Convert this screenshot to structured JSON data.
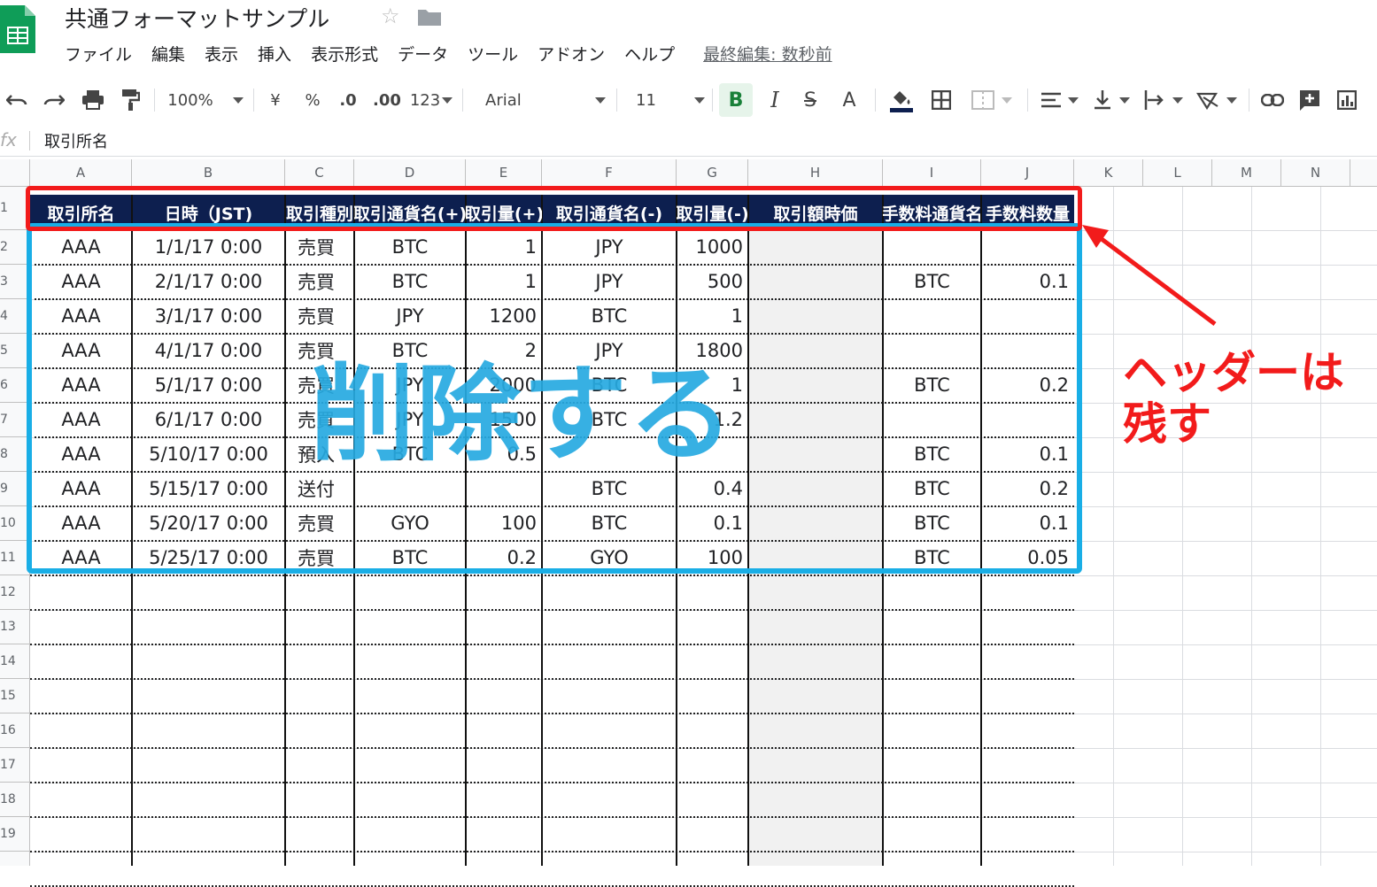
{
  "app": {
    "doc_title": "共通フォーマットサンプル",
    "menus": [
      "ファイル",
      "編集",
      "表示",
      "挿入",
      "表示形式",
      "データ",
      "ツール",
      "アドオン",
      "ヘルプ"
    ],
    "last_edit": "最終編集: 数秒前"
  },
  "toolbar": {
    "zoom": "100%",
    "currency": "¥",
    "percent": "%",
    "decimal_decrease": ".0",
    "decimal_increase": ".00",
    "more_formats": "123",
    "font": "Arial",
    "font_size": "11",
    "bold": "B",
    "italic": "I",
    "strike": "S",
    "text_color": "A"
  },
  "formula_bar": {
    "fx": "fx",
    "content": "取引所名"
  },
  "columns": [
    "A",
    "B",
    "C",
    "D",
    "E",
    "F",
    "G",
    "H",
    "I",
    "J",
    "K",
    "L",
    "M",
    "N"
  ],
  "rows": [
    "1",
    "2",
    "3",
    "4",
    "5",
    "6",
    "7",
    "8",
    "9",
    "10",
    "11",
    "12",
    "13",
    "14",
    "15",
    "16",
    "17",
    "18",
    "19"
  ],
  "headers": [
    "取引所名",
    "日時（JST)",
    "取引種別",
    "取引通貨名(+)",
    "取引量(+)",
    "取引通貨名(-)",
    "取引量(-)",
    "取引額時価",
    "手数料通貨名",
    "手数料数量"
  ],
  "data": [
    [
      "AAA",
      "1/1/17 0:00",
      "売買",
      "BTC",
      "1",
      "JPY",
      "1000",
      "",
      "",
      ""
    ],
    [
      "AAA",
      "2/1/17 0:00",
      "売買",
      "BTC",
      "1",
      "JPY",
      "500",
      "",
      "BTC",
      "0.1"
    ],
    [
      "AAA",
      "3/1/17 0:00",
      "売買",
      "JPY",
      "1200",
      "BTC",
      "1",
      "",
      "",
      ""
    ],
    [
      "AAA",
      "4/1/17 0:00",
      "売買",
      "BTC",
      "2",
      "JPY",
      "1800",
      "",
      "",
      ""
    ],
    [
      "AAA",
      "5/1/17 0:00",
      "売買",
      "JPY",
      "2000",
      "BTC",
      "1",
      "",
      "BTC",
      "0.2"
    ],
    [
      "AAA",
      "6/1/17 0:00",
      "売買",
      "JPY",
      "1500",
      "BTC",
      "1.2",
      "",
      "",
      ""
    ],
    [
      "AAA",
      "5/10/17 0:00",
      "預入",
      "BTC",
      "0.5",
      "",
      "",
      "",
      "BTC",
      "0.1"
    ],
    [
      "AAA",
      "5/15/17 0:00",
      "送付",
      "",
      "",
      "BTC",
      "0.4",
      "",
      "BTC",
      "0.2"
    ],
    [
      "AAA",
      "5/20/17 0:00",
      "売買",
      "GYO",
      "100",
      "BTC",
      "0.1",
      "",
      "BTC",
      "0.1"
    ],
    [
      "AAA",
      "5/25/17 0:00",
      "売買",
      "BTC",
      "0.2",
      "GYO",
      "100",
      "",
      "BTC",
      "0.05"
    ]
  ],
  "annotations": {
    "delete_label": "削除する",
    "keep_label_line1": "ヘッダーは",
    "keep_label_line2": "残す",
    "delete_color": "#27aae1",
    "keep_color": "#f21b1b"
  },
  "colors": {
    "header_bg": "#0d1f4f",
    "sheets_green": "#0f9d58"
  }
}
